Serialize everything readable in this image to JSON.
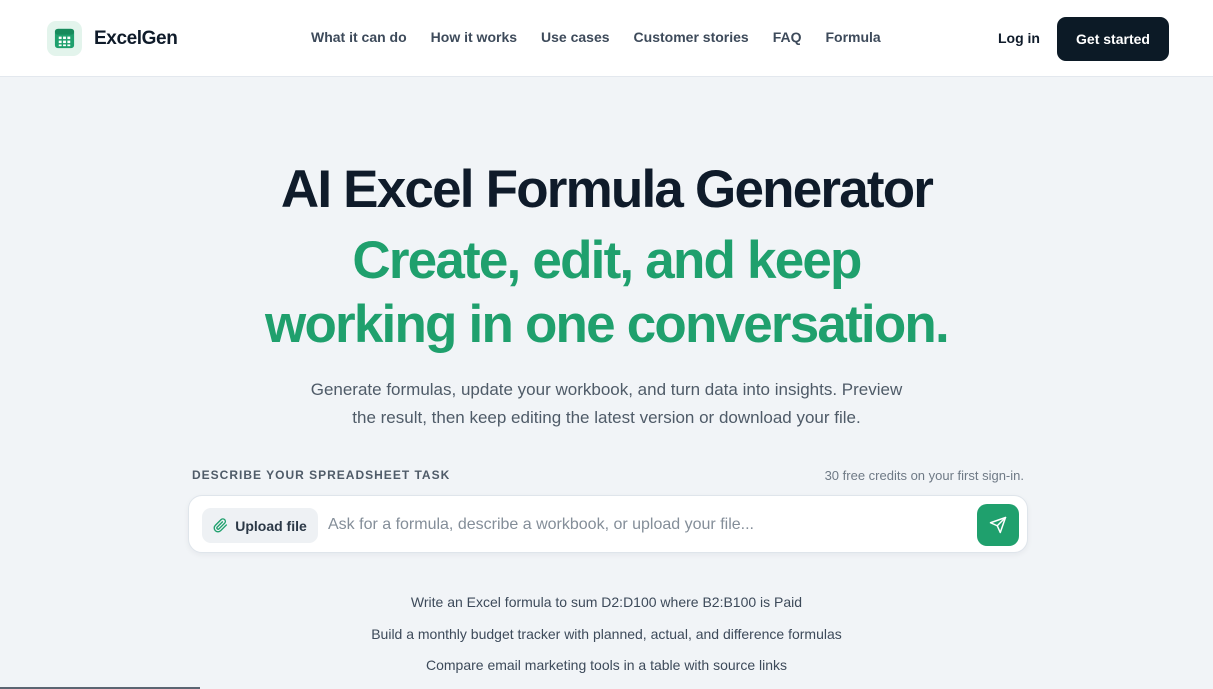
{
  "brand": {
    "name": "ExcelGen",
    "logo_icon": "spreadsheet-icon",
    "accent": "#1fa06d",
    "dark": "#0c1a26"
  },
  "nav": {
    "items": [
      {
        "label": "What it can do"
      },
      {
        "label": "How it works"
      },
      {
        "label": "Use cases"
      },
      {
        "label": "Customer stories"
      },
      {
        "label": "FAQ"
      },
      {
        "label": "Formula"
      }
    ],
    "login": "Log in",
    "cta": "Get started"
  },
  "hero": {
    "title": "AI Excel Formula Generator",
    "subtitle_line1": "Create, edit, and keep",
    "subtitle_line2": "working in one conversation.",
    "description_line1": "Generate formulas, update your workbook, and turn data into insights. Preview",
    "description_line2": "the result, then keep editing the latest version or download your file."
  },
  "prompt": {
    "label": "DESCRIBE YOUR SPREADSHEET TASK",
    "credits_note": "30 free credits on your first sign-in.",
    "upload_label": "Upload file",
    "upload_icon": "paperclip-icon",
    "placeholder": "Ask for a formula, describe a workbook, or upload your file...",
    "value": "",
    "send_icon": "send-icon"
  },
  "suggestions": [
    "Write an Excel formula to sum D2:D100 where B2:B100 is Paid",
    "Build a monthly budget tracker with planned, actual, and difference formulas",
    "Compare email marketing tools in a table with source links"
  ]
}
